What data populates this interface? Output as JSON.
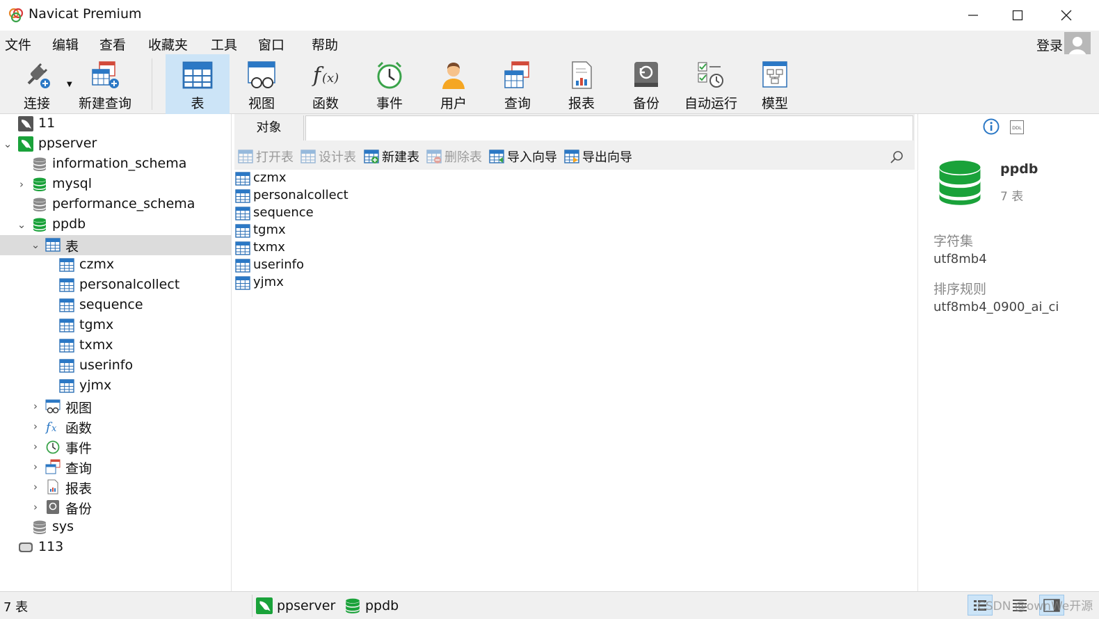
{
  "window": {
    "title": "Navicat Premium"
  },
  "menu": {
    "items": [
      "文件",
      "编辑",
      "查看",
      "收藏夹",
      "工具",
      "窗口",
      "帮助"
    ],
    "login": "登录"
  },
  "toolbar": {
    "connect": "连接",
    "new_query": "新建查询",
    "table": "表",
    "view": "视图",
    "function": "函数",
    "event": "事件",
    "user": "用户",
    "query": "查询",
    "report": "报表",
    "backup": "备份",
    "automation": "自动运行",
    "model": "模型",
    "active": "表"
  },
  "tree": {
    "conn1": "11",
    "conn2": "ppserver",
    "db_information_schema": "information_schema",
    "db_mysql": "mysql",
    "db_performance_schema": "performance_schema",
    "db_ppdb": "ppdb",
    "tables_group": "表",
    "tables": [
      "czmx",
      "personalcollect",
      "sequence",
      "tgmx",
      "txmx",
      "userinfo",
      "yjmx"
    ],
    "views_group": "视图",
    "functions_group": "函数",
    "events_group": "事件",
    "queries_group": "查询",
    "reports_group": "报表",
    "backups_group": "备份",
    "db_sys": "sys",
    "conn3": "113"
  },
  "center": {
    "tab": "对象",
    "actions": {
      "open_table": "打开表",
      "design_table": "设计表",
      "new_table": "新建表",
      "delete_table": "删除表",
      "import_wizard": "导入向导",
      "export_wizard": "导出向导"
    },
    "objects": [
      "czmx",
      "personalcollect",
      "sequence",
      "tgmx",
      "txmx",
      "userinfo",
      "yjmx"
    ]
  },
  "info": {
    "db_name": "ppdb",
    "table_count": "7 表",
    "charset_label": "字符集",
    "charset_value": "utf8mb4",
    "collation_label": "排序规则",
    "collation_value": "utf8mb4_0900_ai_ci",
    "ddl_icon_text": "DDL"
  },
  "status": {
    "count": "7 表",
    "connection": "ppserver",
    "database": "ppdb",
    "watermark": "CSDN @ownWe开源"
  },
  "colors": {
    "accent": "#2b78c5",
    "selected_tab": "#cce4f7",
    "db_green": "#1aa23a",
    "tree_selected": "#dcdcdc"
  }
}
